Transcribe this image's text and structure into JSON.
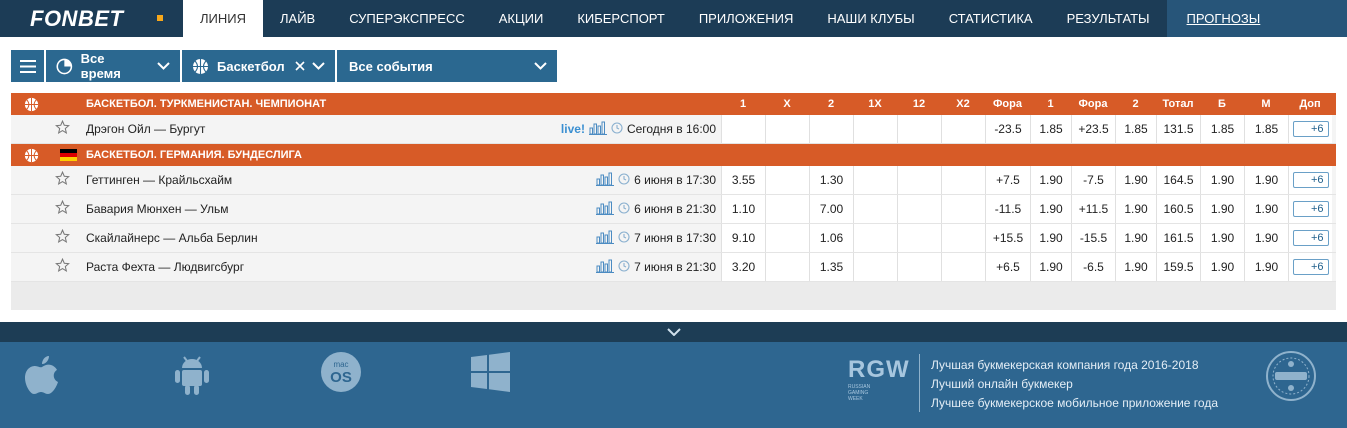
{
  "brand": {
    "name": "FONBET",
    "dot_color": "#f7a81b"
  },
  "nav": {
    "items": [
      "Линия",
      "Лайв",
      "Суперэкспресс",
      "Акции",
      "Киберспорт",
      "Приложения",
      "Наши клубы",
      "Статистика",
      "Результаты"
    ],
    "active_index": 0,
    "extra": "Прогнозы"
  },
  "filters": {
    "menu_icon": "hamburger-icon",
    "period": "Все время",
    "sport": "Баскетбол",
    "events": "Все события"
  },
  "columns": [
    "1",
    "X",
    "2",
    "1X",
    "12",
    "X2",
    "Фора",
    "1",
    "Фора",
    "2",
    "Тотал",
    "Б",
    "М",
    "Доп"
  ],
  "leagues": [
    {
      "title": "Баскетбол. Туркменистан. Чемпионат",
      "flag": "",
      "events": [
        {
          "name": "Дрэгон Ойл — Бургут",
          "live": "live!",
          "time": "Сегодня в 16:00",
          "odds": [
            "",
            "",
            "",
            "",
            "",
            "",
            "-23.5",
            "1.85",
            "+23.5",
            "1.85",
            "131.5",
            "1.85",
            "1.85"
          ],
          "more": "+6"
        }
      ]
    },
    {
      "title": "Баскетбол. Германия. Бундеслига",
      "flag": "germany-flag",
      "events": [
        {
          "name": "Геттинген — Крайльсхайм",
          "live": "",
          "time": "6 июня в 17:30",
          "odds": [
            "3.55",
            "",
            "1.30",
            "",
            "",
            "",
            "+7.5",
            "1.90",
            "-7.5",
            "1.90",
            "164.5",
            "1.90",
            "1.90"
          ],
          "more": "+6"
        },
        {
          "name": "Бавария Мюнхен — Ульм",
          "live": "",
          "time": "6 июня в 21:30",
          "odds": [
            "1.10",
            "",
            "7.00",
            "",
            "",
            "",
            "-11.5",
            "1.90",
            "+11.5",
            "1.90",
            "160.5",
            "1.90",
            "1.90"
          ],
          "more": "+6"
        },
        {
          "name": "Скайлайнерс — Альба Берлин",
          "live": "",
          "time": "7 июня в 17:30",
          "odds": [
            "9.10",
            "",
            "1.06",
            "",
            "",
            "",
            "+15.5",
            "1.90",
            "-15.5",
            "1.90",
            "161.5",
            "1.90",
            "1.90"
          ],
          "more": "+6"
        },
        {
          "name": "Раста Фехта — Людвигсбург",
          "live": "",
          "time": "7 июня в 21:30",
          "odds": [
            "3.20",
            "",
            "1.35",
            "",
            "",
            "",
            "+6.5",
            "1.90",
            "-6.5",
            "1.90",
            "159.5",
            "1.90",
            "1.90"
          ],
          "more": "+6"
        }
      ]
    }
  ],
  "footer": {
    "apps": [
      "apple-icon",
      "android-icon",
      "macos-icon",
      "windows-icon"
    ],
    "macos_label": {
      "top": "mac",
      "bottom": "OS"
    },
    "rgw": {
      "logo": "RGW",
      "sub": [
        "RUSSIAN",
        "GAMING",
        "WEEK"
      ]
    },
    "awards": [
      "Лучшая букмекерская компания года 2016-2018",
      "Лучший онлайн букмекер",
      "Лучшее букмекерское мобильное приложение года"
    ],
    "seal_icon": "award-seal-icon"
  },
  "colors": {
    "nav_bg": "#1c3c56",
    "league_header": "#d75b27",
    "filter_bg": "#2b6890",
    "footer_bg": "#2e6690",
    "live": "#3a8fd1"
  }
}
